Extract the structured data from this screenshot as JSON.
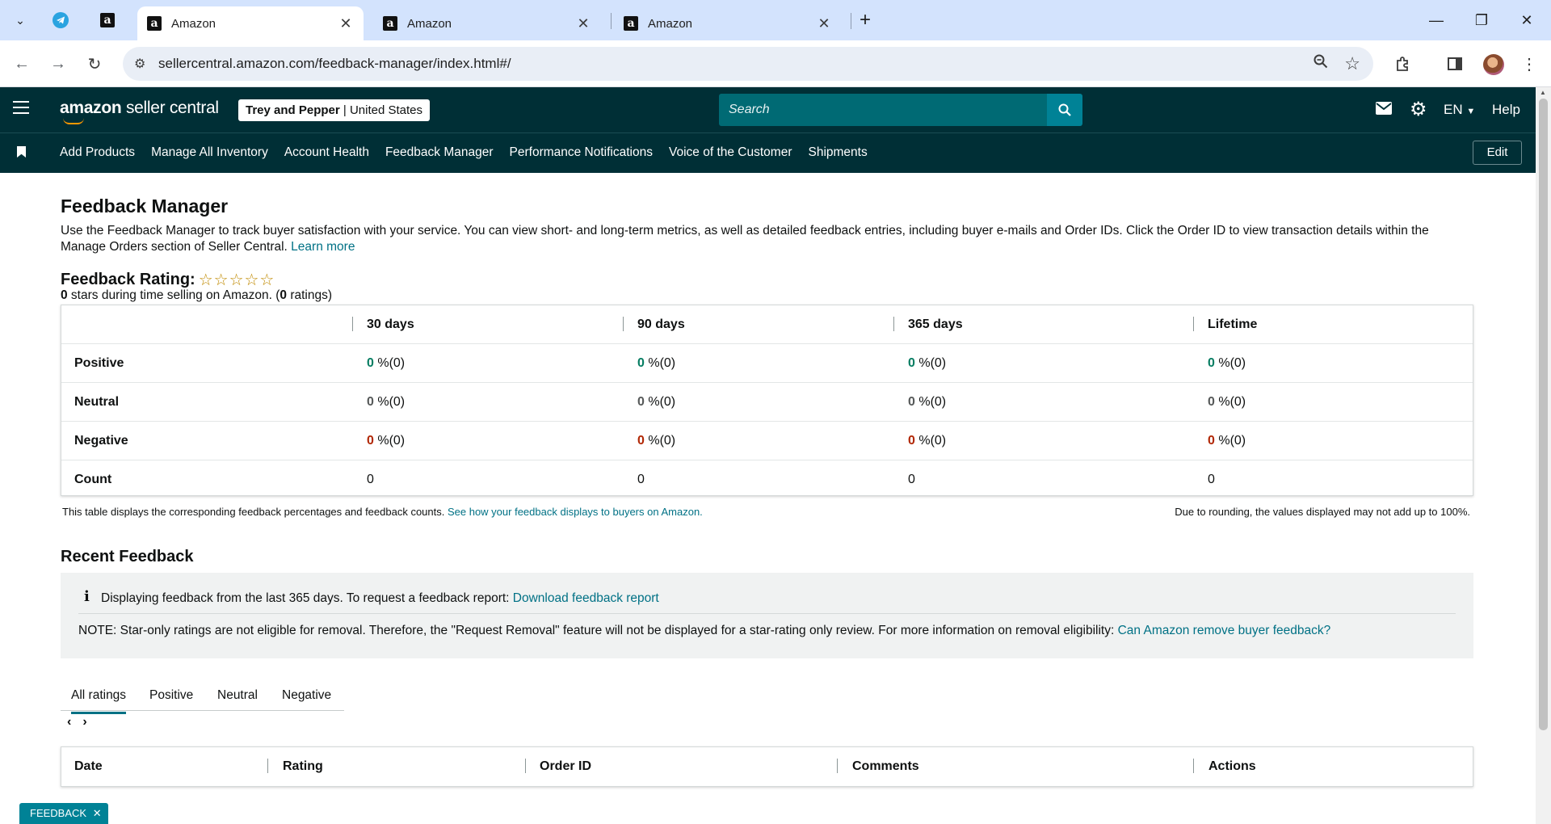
{
  "browser": {
    "tabs": [
      {
        "title": "Amazon",
        "active": true
      },
      {
        "title": "Amazon",
        "active": false
      },
      {
        "title": "Amazon",
        "active": false
      }
    ],
    "url": "sellercentral.amazon.com/feedback-manager/index.html#/"
  },
  "header": {
    "logo_main": "amazon",
    "logo_sub": "seller central",
    "store_name": "Trey and Pepper",
    "store_region": "United States",
    "search_placeholder": "Search",
    "language": "EN",
    "help": "Help"
  },
  "nav": {
    "links": [
      "Add Products",
      "Manage All Inventory",
      "Account Health",
      "Feedback Manager",
      "Performance Notifications",
      "Voice of the Customer",
      "Shipments"
    ],
    "edit_label": "Edit"
  },
  "page": {
    "title": "Feedback Manager",
    "intro": "Use the Feedback Manager to track buyer satisfaction with your service. You can view short- and long-term metrics, as well as detailed feedback entries, including buyer e-mails and Order IDs. Click the Order ID to view transaction details within the Manage Orders section of Seller Central.",
    "learn_more": "Learn more",
    "rating_label": "Feedback Rating:",
    "stars": "☆☆☆☆☆",
    "rating_stars_value": 0,
    "stars_count": "0",
    "stars_text": " stars during time selling on Amazon. (",
    "ratings_count": "0",
    "ratings_text": " ratings)"
  },
  "feedback_table": {
    "columns": [
      "30 days",
      "90 days",
      "365 days",
      "Lifetime"
    ],
    "rows": [
      {
        "label": "Positive",
        "values": [
          "0",
          "0",
          "0",
          "0"
        ],
        "suffix": " %(0)"
      },
      {
        "label": "Neutral",
        "values": [
          "0",
          "0",
          "0",
          "0"
        ],
        "suffix": " %(0)"
      },
      {
        "label": "Negative",
        "values": [
          "0",
          "0",
          "0",
          "0"
        ],
        "suffix": " %(0)"
      },
      {
        "label": "Count",
        "values": [
          "0",
          "0",
          "0",
          "0"
        ],
        "suffix": ""
      }
    ],
    "note": "This table displays the corresponding feedback percentages and feedback counts.",
    "note_link": "See how your feedback displays to buyers on Amazon.",
    "rounding_note": "Due to rounding, the values displayed may not add up to 100%."
  },
  "recent": {
    "title": "Recent Feedback",
    "info_text": "Displaying feedback from the last 365 days. To request a feedback report:",
    "download_link": "Download feedback report",
    "note_text": "NOTE: Star-only ratings are not eligible for removal. Therefore, the \"Request Removal\" feature will not be displayed for a star-rating only review. For more information on removal eligibility:",
    "note_link": "Can Amazon remove buyer feedback?",
    "tabs": [
      "All ratings",
      "Positive",
      "Neutral",
      "Negative"
    ],
    "pager_prev": "‹",
    "pager_next": "›",
    "columns": [
      "Date",
      "Rating",
      "Order ID",
      "Comments",
      "Actions"
    ]
  },
  "feedback_tag": "FEEDBACK",
  "colors": {
    "header_bg": "#002f36",
    "link": "#007185",
    "positive": "#067d62",
    "negative": "#b12704",
    "search_btn": "#008296"
  }
}
